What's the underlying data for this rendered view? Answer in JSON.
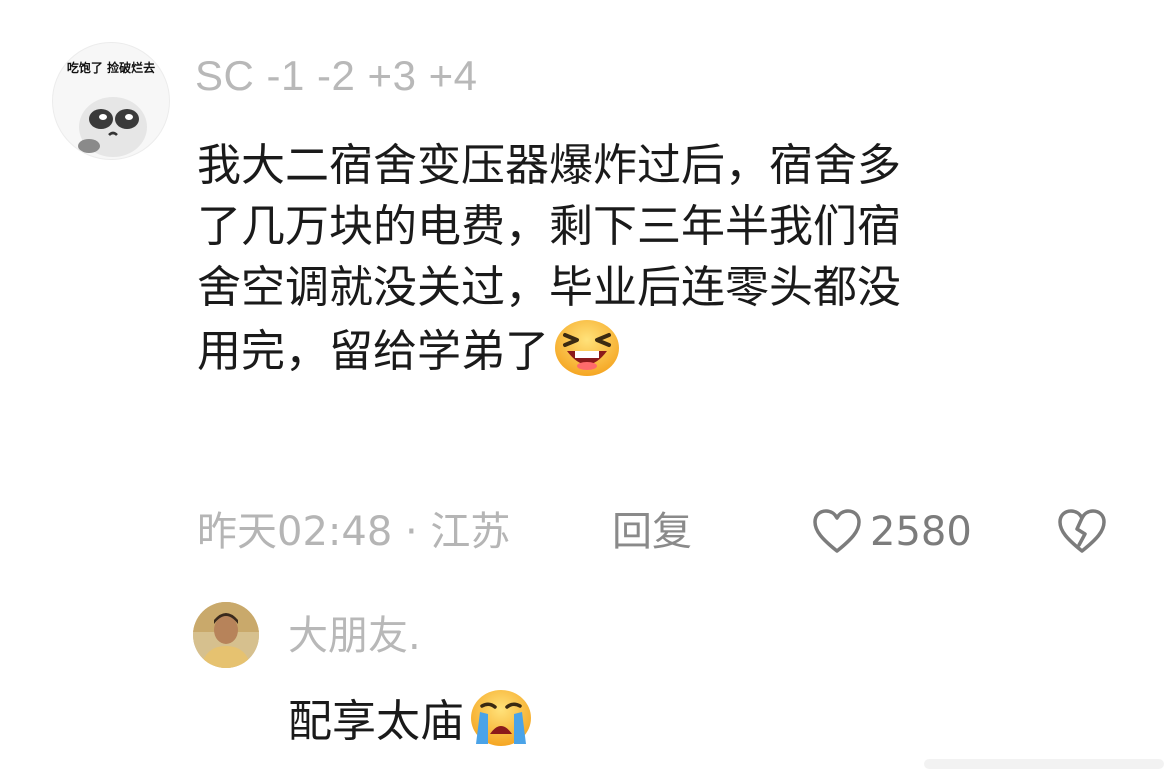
{
  "comment": {
    "avatar_caption": "吃饱了 捡破烂去",
    "username": "SC -1 -2 +3 +4",
    "text_lines": [
      "我大二宿舍变压器爆炸过后，宿舍多",
      "了几万块的电费，剩下三年半我们宿",
      "舍空调就没关过，毕业后连零头都没",
      "用完，留给学弟了"
    ],
    "trailing_emoji": "laughing-emoji",
    "time_location": "昨天02:48 · 江苏",
    "reply_label": "回复",
    "like_count": "2580",
    "icons": {
      "like": "heart-outline-icon",
      "dislike": "broken-heart-icon"
    }
  },
  "reply": {
    "username": "大朋友.",
    "text": "配享太庙",
    "trailing_emoji": "crying-emoji"
  },
  "colors": {
    "text_primary": "#1a1a1a",
    "text_muted": "#b5b5b5",
    "text_action": "#8a8a8a"
  }
}
